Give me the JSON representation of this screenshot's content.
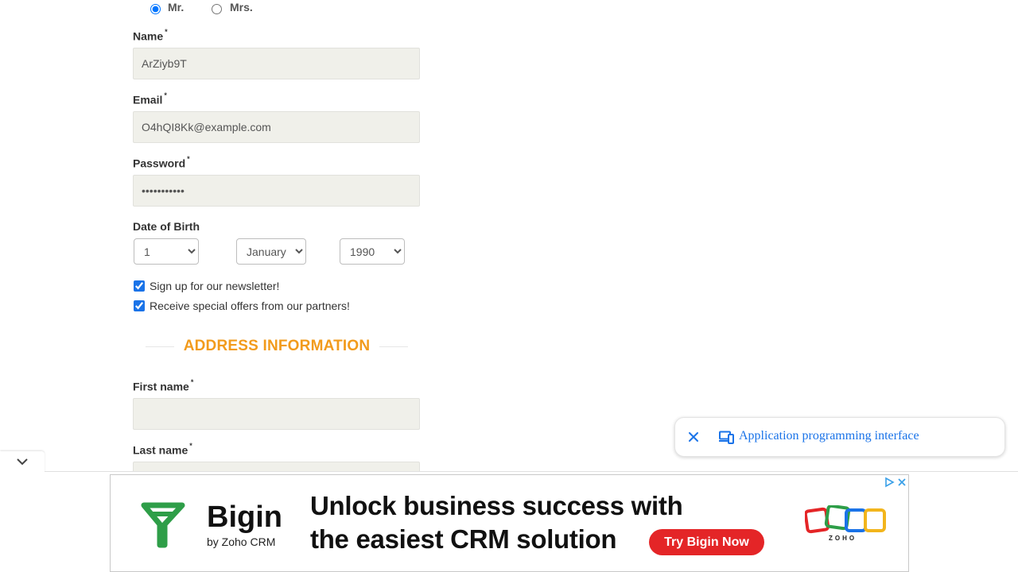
{
  "title": {
    "radio_options": [
      {
        "label": "Mr.",
        "checked": true
      },
      {
        "label": "Mrs.",
        "checked": false
      }
    ]
  },
  "fields": {
    "name": {
      "label": "Name",
      "required_mark": "*",
      "value": "ArZiyb9T"
    },
    "email": {
      "label": "Email",
      "required_mark": "*",
      "value": "O4hQI8Kk@example.com"
    },
    "password": {
      "label": "Password",
      "required_mark": "*",
      "value": "•••••••••••"
    }
  },
  "dob": {
    "label": "Date of Birth",
    "day": "1",
    "month": "January",
    "year": "1990"
  },
  "checkboxes": [
    {
      "label": "Sign up for our newsletter!",
      "checked": true
    },
    {
      "label": "Receive special offers from our partners!",
      "checked": true
    }
  ],
  "address": {
    "section_title": "ADDRESS INFORMATION",
    "first_name": {
      "label": "First name",
      "required_mark": "*",
      "value": ""
    },
    "last_name": {
      "label": "Last name",
      "required_mark": "*",
      "value": ""
    }
  },
  "ad": {
    "brand": "Bigin",
    "brand_sub": "by Zoho CRM",
    "headline_1": "Unlock business success with",
    "headline_2": "the easiest CRM solution",
    "cta": "Try Bigin Now",
    "partner_logo_text": "ZOHO"
  },
  "popup": {
    "text": "Application programming interface"
  },
  "colors": {
    "section_accent": "#f29b1c",
    "input_bg": "#f0f0ea",
    "ad_cta": "#e42527",
    "ad_brand_green": "#2e9e48",
    "link_blue": "#1a73e8"
  },
  "icons": [
    "close-icon",
    "devices-icon",
    "chevron-down-icon",
    "adchoices-icon"
  ]
}
